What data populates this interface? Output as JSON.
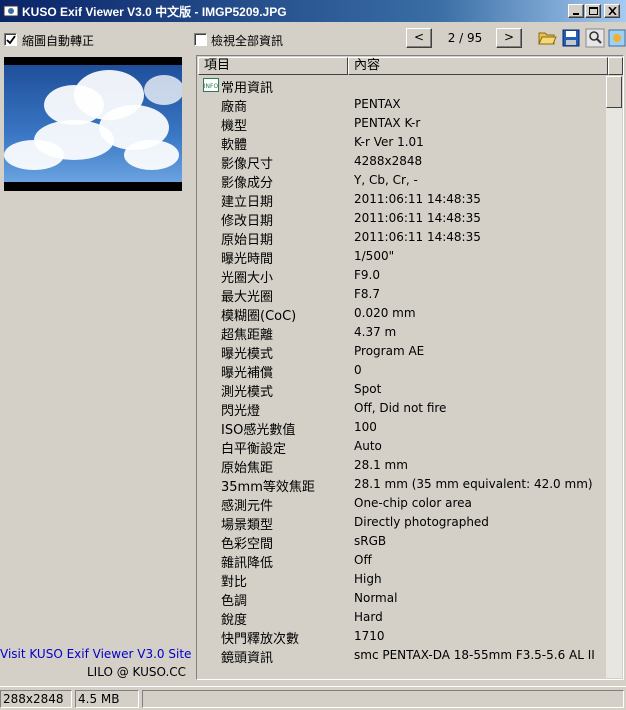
{
  "window": {
    "title": "KUSO Exif Viewer V3.0 中文版 - IMGP5209.JPG"
  },
  "toolbar": {
    "auto_rotate_label": "縮圖自動轉正",
    "auto_rotate_checked": true,
    "show_all_label": "檢視全部資訊",
    "show_all_checked": false,
    "prev_label": "<",
    "next_label": ">",
    "page_indicator": "2 / 95"
  },
  "left": {
    "site_link": "Visit KUSO Exif Viewer V3.0 Site",
    "credit": "LILO @ KUSO.CC"
  },
  "list": {
    "columns": [
      "項目",
      "內容"
    ],
    "group_icon_text": "INFO",
    "group_label": "常用資訊",
    "rows": [
      {
        "k": "廠商",
        "v": "PENTAX"
      },
      {
        "k": "機型",
        "v": "PENTAX K-r"
      },
      {
        "k": "軟體",
        "v": "K-r Ver 1.01"
      },
      {
        "k": "影像尺寸",
        "v": "4288x2848"
      },
      {
        "k": "影像成分",
        "v": "Y, Cb, Cr, -"
      },
      {
        "k": "建立日期",
        "v": "2011:06:11 14:48:35"
      },
      {
        "k": "修改日期",
        "v": "2011:06:11 14:48:35"
      },
      {
        "k": "原始日期",
        "v": "2011:06:11 14:48:35"
      },
      {
        "k": "曝光時間",
        "v": "1/500\""
      },
      {
        "k": "光圈大小",
        "v": "F9.0"
      },
      {
        "k": "最大光圈",
        "v": "F8.7"
      },
      {
        "k": "模糊圈(CoC)",
        "v": "0.020 mm"
      },
      {
        "k": "超焦距離",
        "v": "4.37 m"
      },
      {
        "k": "曝光模式",
        "v": "Program AE"
      },
      {
        "k": "曝光補償",
        "v": "0"
      },
      {
        "k": "測光模式",
        "v": "Spot"
      },
      {
        "k": "閃光燈",
        "v": "Off, Did not fire"
      },
      {
        "k": "ISO感光數值",
        "v": "100"
      },
      {
        "k": "白平衡設定",
        "v": "Auto"
      },
      {
        "k": "原始焦距",
        "v": "28.1 mm"
      },
      {
        "k": "35mm等效焦距",
        "v": "28.1 mm (35 mm equivalent: 42.0 mm)"
      },
      {
        "k": "感測元件",
        "v": "One-chip color area"
      },
      {
        "k": "場景類型",
        "v": "Directly photographed"
      },
      {
        "k": "色彩空間",
        "v": "sRGB"
      },
      {
        "k": "雜訊降低",
        "v": "Off"
      },
      {
        "k": "對比",
        "v": "High"
      },
      {
        "k": "色調",
        "v": "Normal"
      },
      {
        "k": "銳度",
        "v": "Hard"
      },
      {
        "k": "快門釋放次數",
        "v": "1710"
      },
      {
        "k": "鏡頭資訊",
        "v": "smc PENTAX-DA 18-55mm F3.5-5.6 AL II"
      }
    ]
  },
  "status": {
    "dimensions": "288x2848",
    "file_size": "4.5 MB"
  }
}
